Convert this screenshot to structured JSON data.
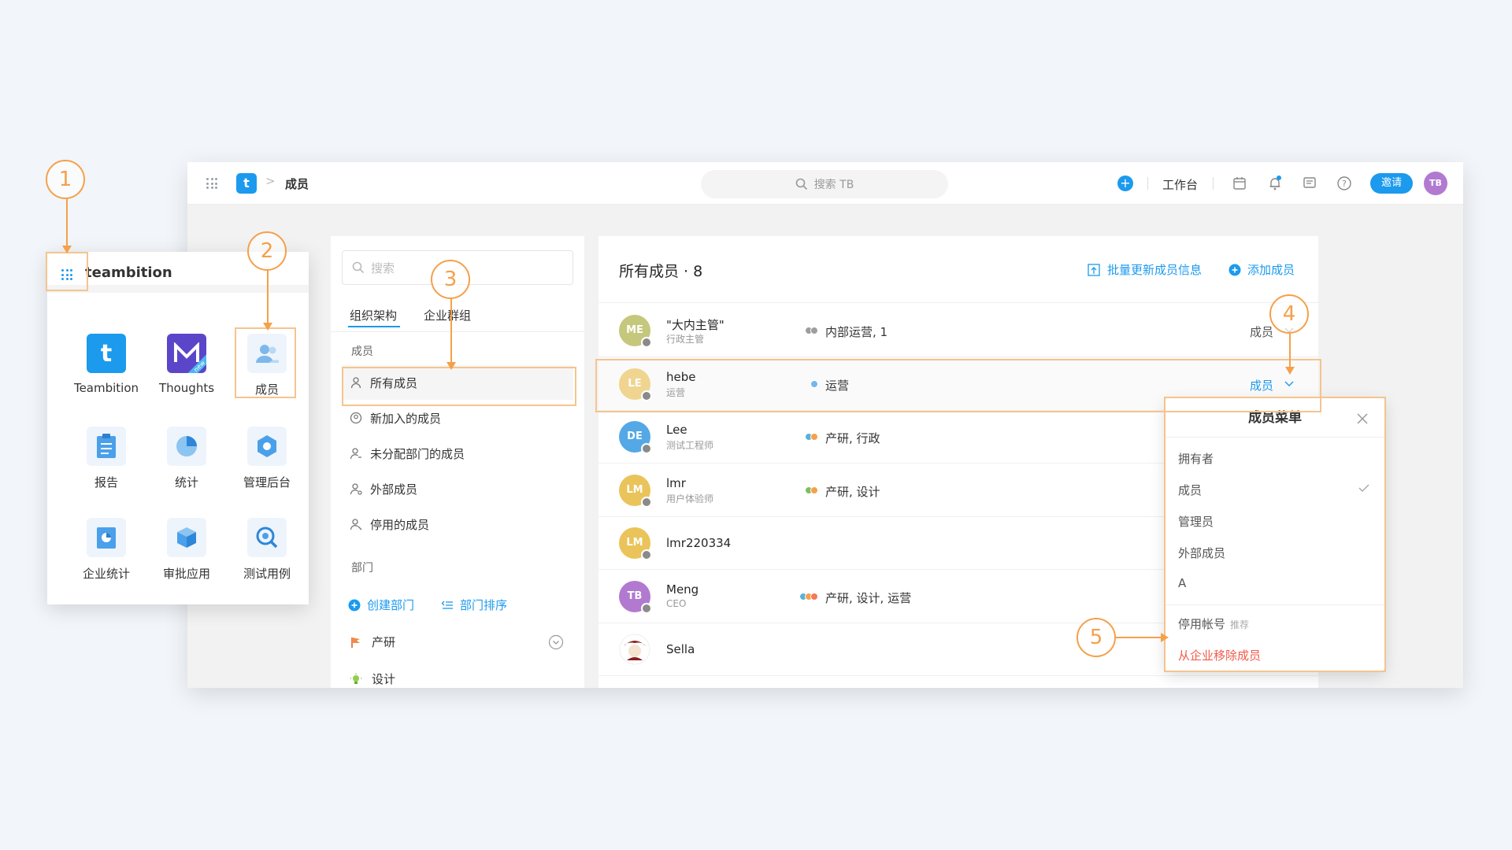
{
  "topbar": {
    "breadcrumb_logo": "t",
    "breadcrumb_sep": ">",
    "title": "成员",
    "search_placeholder": "搜索 TB",
    "workbench_label": "工作台",
    "invite_label": "邀请",
    "user_avatar": "TB"
  },
  "leftnav": {
    "search_placeholder": "搜索",
    "tabs": [
      {
        "label": "组织架构",
        "active": true
      },
      {
        "label": "企业群组",
        "active": false
      }
    ],
    "members_section": "成员",
    "items": [
      {
        "label": "所有成员",
        "selected": true
      },
      {
        "label": "新加入的成员",
        "selected": false
      },
      {
        "label": "未分配部门的成员",
        "selected": false
      },
      {
        "label": "外部成员",
        "selected": false
      },
      {
        "label": "停用的成员",
        "selected": false
      }
    ],
    "dept_section": "部门",
    "create_dept": "创建部门",
    "sort_dept": "部门排序",
    "depts": [
      {
        "label": "产研",
        "icon": "flag-icon"
      },
      {
        "label": "设计",
        "icon": "lightbulb-icon"
      }
    ]
  },
  "main": {
    "title": "所有成员 · 8",
    "batch_update": "批量更新成员信息",
    "add_member": "添加成员",
    "rows": [
      {
        "initials": "ME",
        "color": "#c5c77c",
        "name": "\"大内主管\"",
        "sub": "行政主管",
        "dots": [
          "#9e9e9e",
          "#9e9e9e"
        ],
        "dept": "内部运营, 1",
        "role": "成员"
      },
      {
        "initials": "LE",
        "color": "#f0d590",
        "name": "hebe",
        "sub": "运营",
        "dots": [
          "#74b7ea"
        ],
        "dept": "运营",
        "role": "成员"
      },
      {
        "initials": "DE",
        "color": "#54a8e6",
        "name": "Lee",
        "sub": "测试工程师",
        "dots": [
          "#5ab2d8",
          "#f6a04d"
        ],
        "dept": "产研, 行政",
        "role": ""
      },
      {
        "initials": "LM",
        "color": "#eac45a",
        "name": "lmr",
        "sub": "用户体验师",
        "dots": [
          "#7cc15a",
          "#f6a04d"
        ],
        "dept": "产研, 设计",
        "role": ""
      },
      {
        "initials": "LM",
        "color": "#eac45a",
        "name": "lmr220334",
        "sub": "",
        "dots": [],
        "dept": "",
        "role": ""
      },
      {
        "initials": "TB",
        "color": "#b17ad0",
        "name": "Meng",
        "sub": "CEO",
        "dots": [
          "#5ab2d8",
          "#f6a04d",
          "#f27a55"
        ],
        "dept": "产研, 设计, 运营",
        "role": ""
      },
      {
        "initials": "",
        "color": "#ffffff",
        "name": "Sella",
        "sub": "",
        "dots": [],
        "dept": "",
        "role": ""
      }
    ]
  },
  "menu": {
    "title": "成员菜单",
    "items": [
      "拥有者",
      "成员",
      "管理员",
      "外部成员",
      "A"
    ],
    "checked_index": 1,
    "disable_account": "停用帐号",
    "disable_tag": "推荐",
    "remove_member": "从企业移除成员"
  },
  "launcher": {
    "brand": "teambition",
    "apps": [
      {
        "label": "Teambition",
        "icon": "teambition-logo-icon"
      },
      {
        "label": "Thoughts",
        "icon": "thoughts-logo-icon"
      },
      {
        "label": "成员",
        "icon": "members-icon"
      },
      {
        "label": "报告",
        "icon": "report-icon"
      },
      {
        "label": "统计",
        "icon": "pie-chart-icon"
      },
      {
        "label": "管理后台",
        "icon": "admin-icon"
      },
      {
        "label": "企业统计",
        "icon": "enterprise-stats-icon"
      },
      {
        "label": "审批应用",
        "icon": "approval-cube-icon"
      },
      {
        "label": "测试用例",
        "icon": "test-case-icon"
      }
    ],
    "thoughts_badge": "new"
  },
  "callouts": [
    "1",
    "2",
    "3",
    "4",
    "5"
  ],
  "colors": {
    "primary": "#1b9aee",
    "annotation": "#f5a04a",
    "danger": "#f25a4a"
  }
}
